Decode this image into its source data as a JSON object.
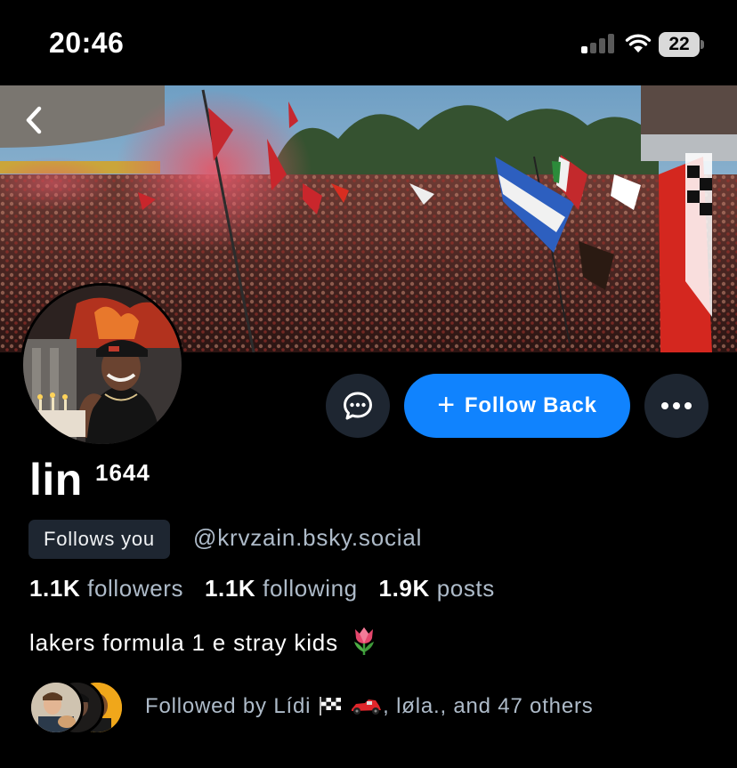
{
  "status_bar": {
    "time": "20:46",
    "battery": "22"
  },
  "profile": {
    "display_name": "lin",
    "name_suffix": "1644",
    "follows_you_label": "Follows you",
    "handle": "@krvzain.bsky.social",
    "bio_text": "lakers formula 1 e stray kids",
    "bio_emoji": "tulip-icon"
  },
  "actions": {
    "follow_label": "Follow Back",
    "message_icon": "chat-bubble-icon",
    "more_icon": "ellipsis-icon",
    "back_icon": "chevron-left-icon"
  },
  "stats": {
    "followers_count": "1.1K",
    "followers_label": "followers",
    "following_count": "1.1K",
    "following_label": "following",
    "posts_count": "1.9K",
    "posts_label": "posts"
  },
  "followed_by": {
    "prefix": "Followed by Lídi",
    "suffix": ", løla., and 47 others"
  },
  "colors": {
    "background": "#000000",
    "accent": "#1083fe",
    "secondary_text": "#aebbc9",
    "button_dark": "#1e2631"
  }
}
